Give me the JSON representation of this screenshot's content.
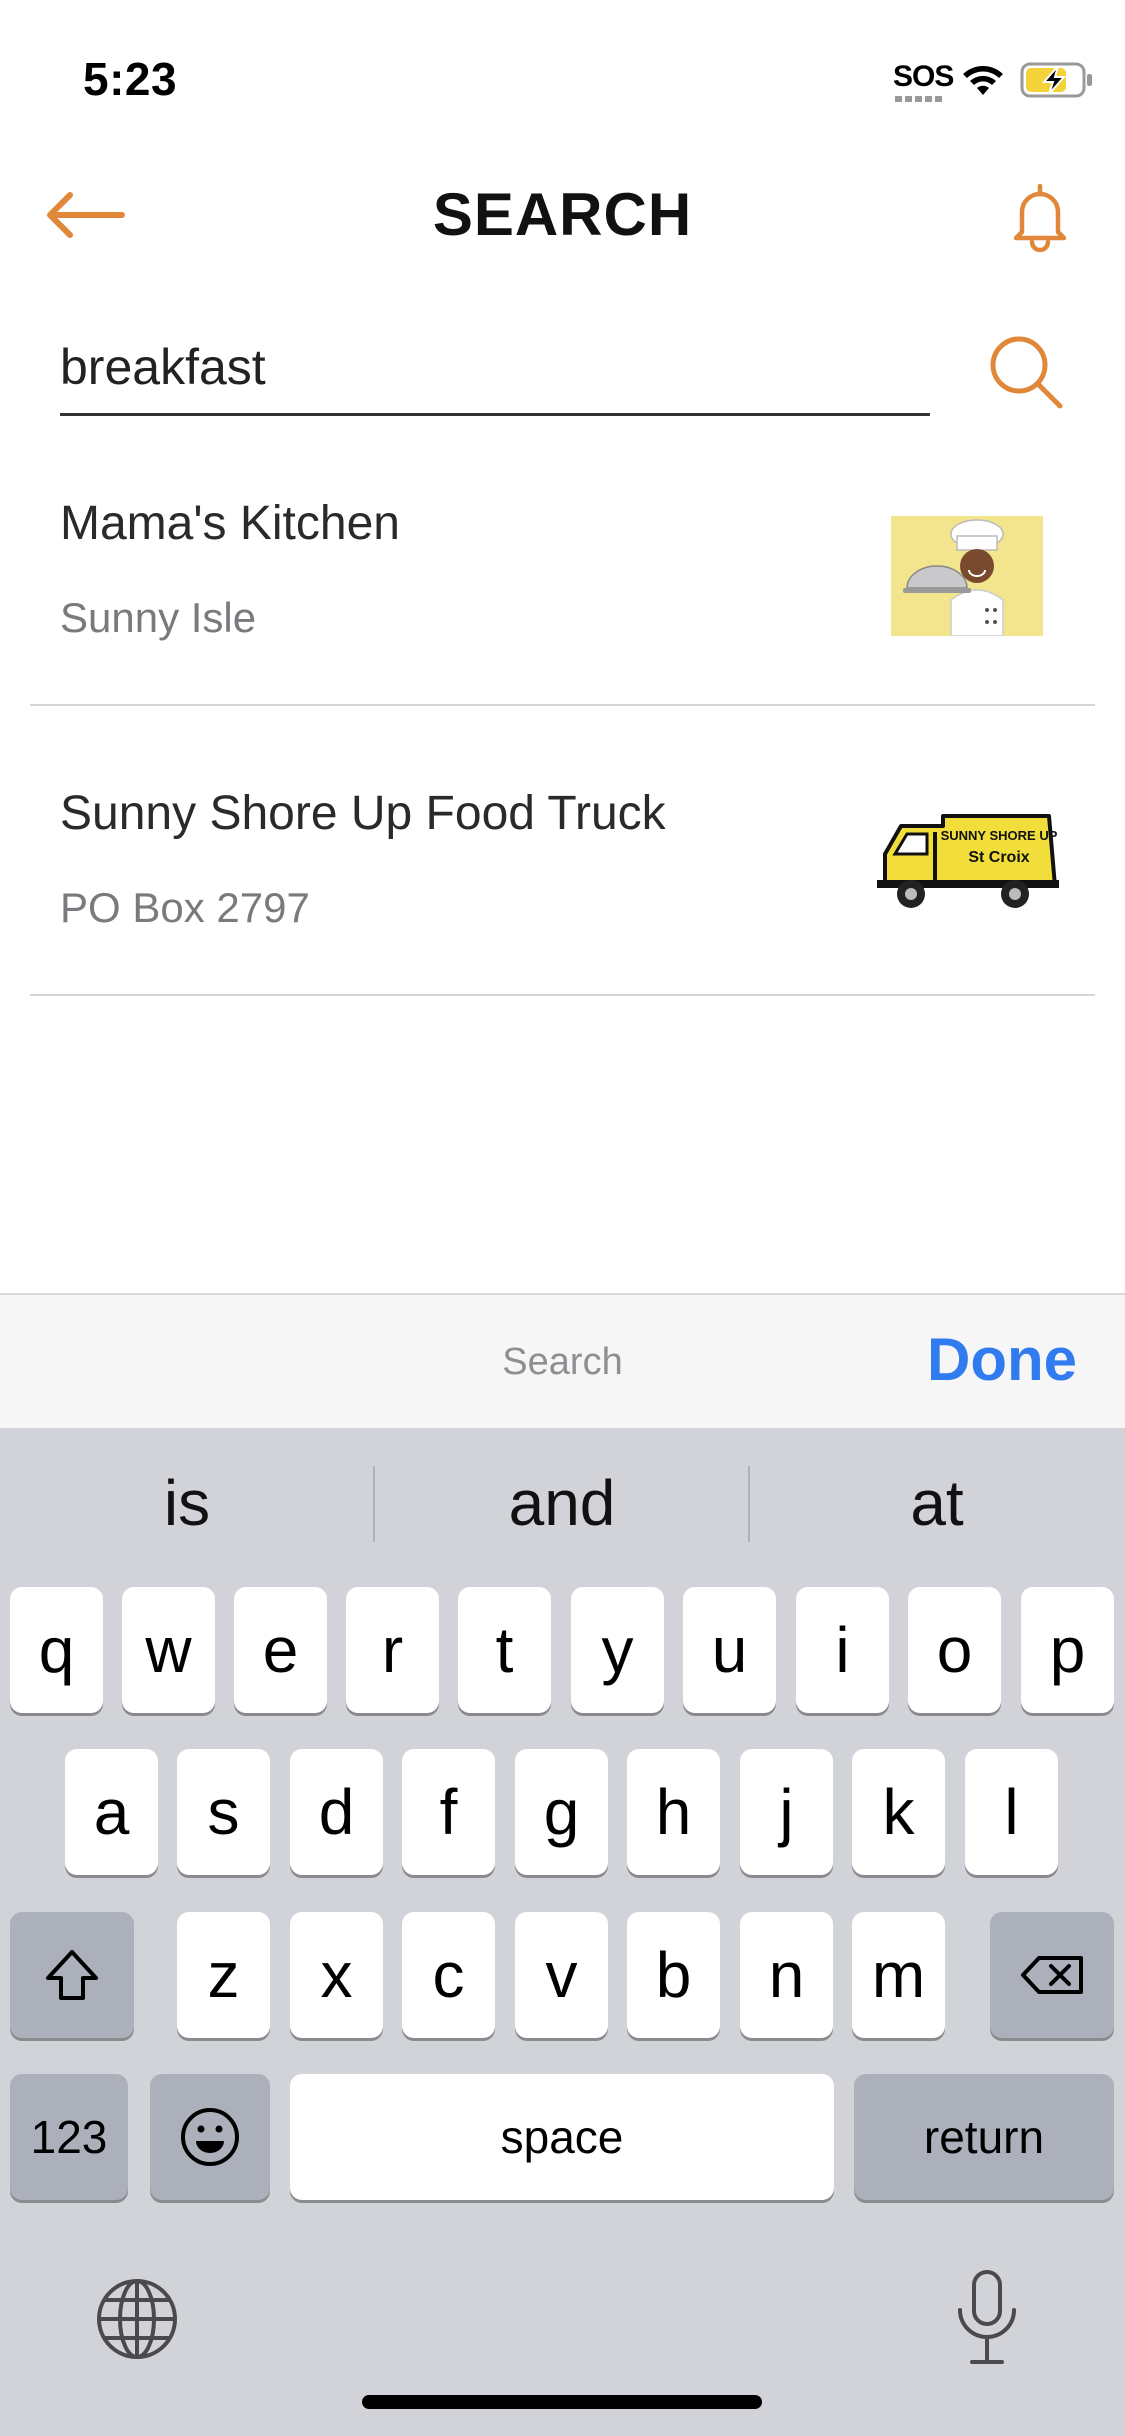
{
  "status_bar": {
    "time": "5:23",
    "sos": "SOS"
  },
  "header": {
    "title": "SEARCH"
  },
  "search": {
    "value": "breakfast",
    "placeholder": ""
  },
  "results": [
    {
      "name": "Mama's Kitchen",
      "subtitle": "Sunny Isle"
    },
    {
      "name": "Sunny Shore Up Food Truck",
      "subtitle": "PO Box 2797",
      "thumb_text_1": "SUNNY SHORE UP",
      "thumb_text_2": "St Croix"
    }
  ],
  "keyboard_toolbar": {
    "title": "Search",
    "done_label": "Done"
  },
  "suggestions": [
    "is",
    "and",
    "at"
  ],
  "keys": {
    "row1": [
      "q",
      "w",
      "e",
      "r",
      "t",
      "y",
      "u",
      "i",
      "o",
      "p"
    ],
    "row2": [
      "a",
      "s",
      "d",
      "f",
      "g",
      "h",
      "j",
      "k",
      "l"
    ],
    "row3": [
      "z",
      "x",
      "c",
      "v",
      "b",
      "n",
      "m"
    ],
    "numbers": "123",
    "space": "space",
    "return": "return"
  },
  "colors": {
    "accent": "#e0873a",
    "done_blue": "#2f7bef",
    "battery_yellow": "#f3d23a"
  }
}
